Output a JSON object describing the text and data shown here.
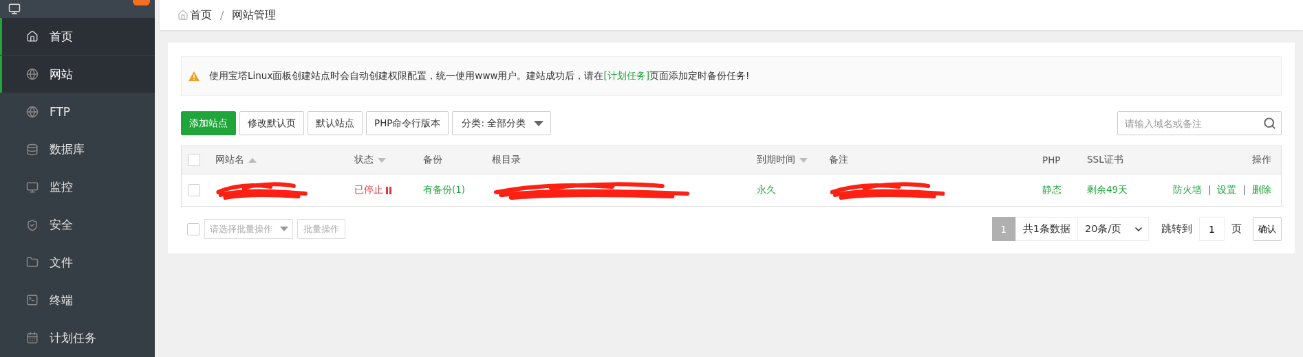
{
  "sidebar": {
    "items": [
      {
        "label": "首页",
        "selected": true
      },
      {
        "label": "网站",
        "selected": true
      },
      {
        "label": "FTP",
        "selected": false
      },
      {
        "label": "数据库",
        "selected": false
      },
      {
        "label": "监控",
        "selected": false
      },
      {
        "label": "安全",
        "selected": false
      },
      {
        "label": "文件",
        "selected": false
      },
      {
        "label": "终端",
        "selected": false
      },
      {
        "label": "计划任务",
        "selected": false
      }
    ]
  },
  "breadcrumb": {
    "items": [
      "首页",
      "网站管理"
    ],
    "separator": "/"
  },
  "notice": {
    "before": "使用宝塔Linux面板创建站点时会自动创建权限配置，统一使用www用户。建站成功后，请在",
    "link": "[计划任务]",
    "after": "页面添加定时备份任务!"
  },
  "toolbar": {
    "buttons": [
      {
        "label": "添加站点",
        "primary": true
      },
      {
        "label": "修改默认页",
        "primary": false
      },
      {
        "label": "默认站点",
        "primary": false
      },
      {
        "label": "PHP命令行版本",
        "primary": false
      }
    ],
    "category": "分类: 全部分类",
    "search": {
      "placeholder": "请输入域名或备注"
    }
  },
  "table": {
    "columns": [
      {
        "label": "网站名",
        "sort_up": true,
        "sort_down": false
      },
      {
        "label": "状态",
        "sort_up": false,
        "sort_down": true
      },
      {
        "label": "备份",
        "sort_up": false,
        "sort_down": false
      },
      {
        "label": "根目录",
        "sort_up": false,
        "sort_down": false
      },
      {
        "label": "到期时间",
        "sort_up": false,
        "sort_down": true
      },
      {
        "label": "备注",
        "sort_up": false,
        "sort_down": false
      },
      {
        "label": "PHP",
        "sort_up": false,
        "sort_down": false
      },
      {
        "label": "SSL证书",
        "sort_up": false,
        "sort_down": false
      },
      {
        "label": "操作",
        "sort_up": false,
        "sort_down": false
      }
    ],
    "all_checked": false,
    "rows": [
      {
        "checked": false,
        "name_redacted": true,
        "status": "已停止",
        "stopped": true,
        "backup": "有备份(1)",
        "root_redacted": true,
        "expiry": "永久",
        "note_redacted": true,
        "php": "静态",
        "ssl": "剩余49天",
        "actions": [
          "防火墙",
          "设置",
          "删除"
        ],
        "action_separators": [
          "|",
          "|"
        ]
      }
    ]
  },
  "batch": {
    "checked": false,
    "placeholder": "请选择批量操作",
    "button": "批量操作"
  },
  "pagination": {
    "pages": [
      {
        "label": "1",
        "selected": true
      }
    ],
    "total": "共1条数据",
    "page_size": "20条/页",
    "jump_label": "跳转到",
    "jump_value": "1",
    "page_unit": "页",
    "confirm": "确认"
  }
}
